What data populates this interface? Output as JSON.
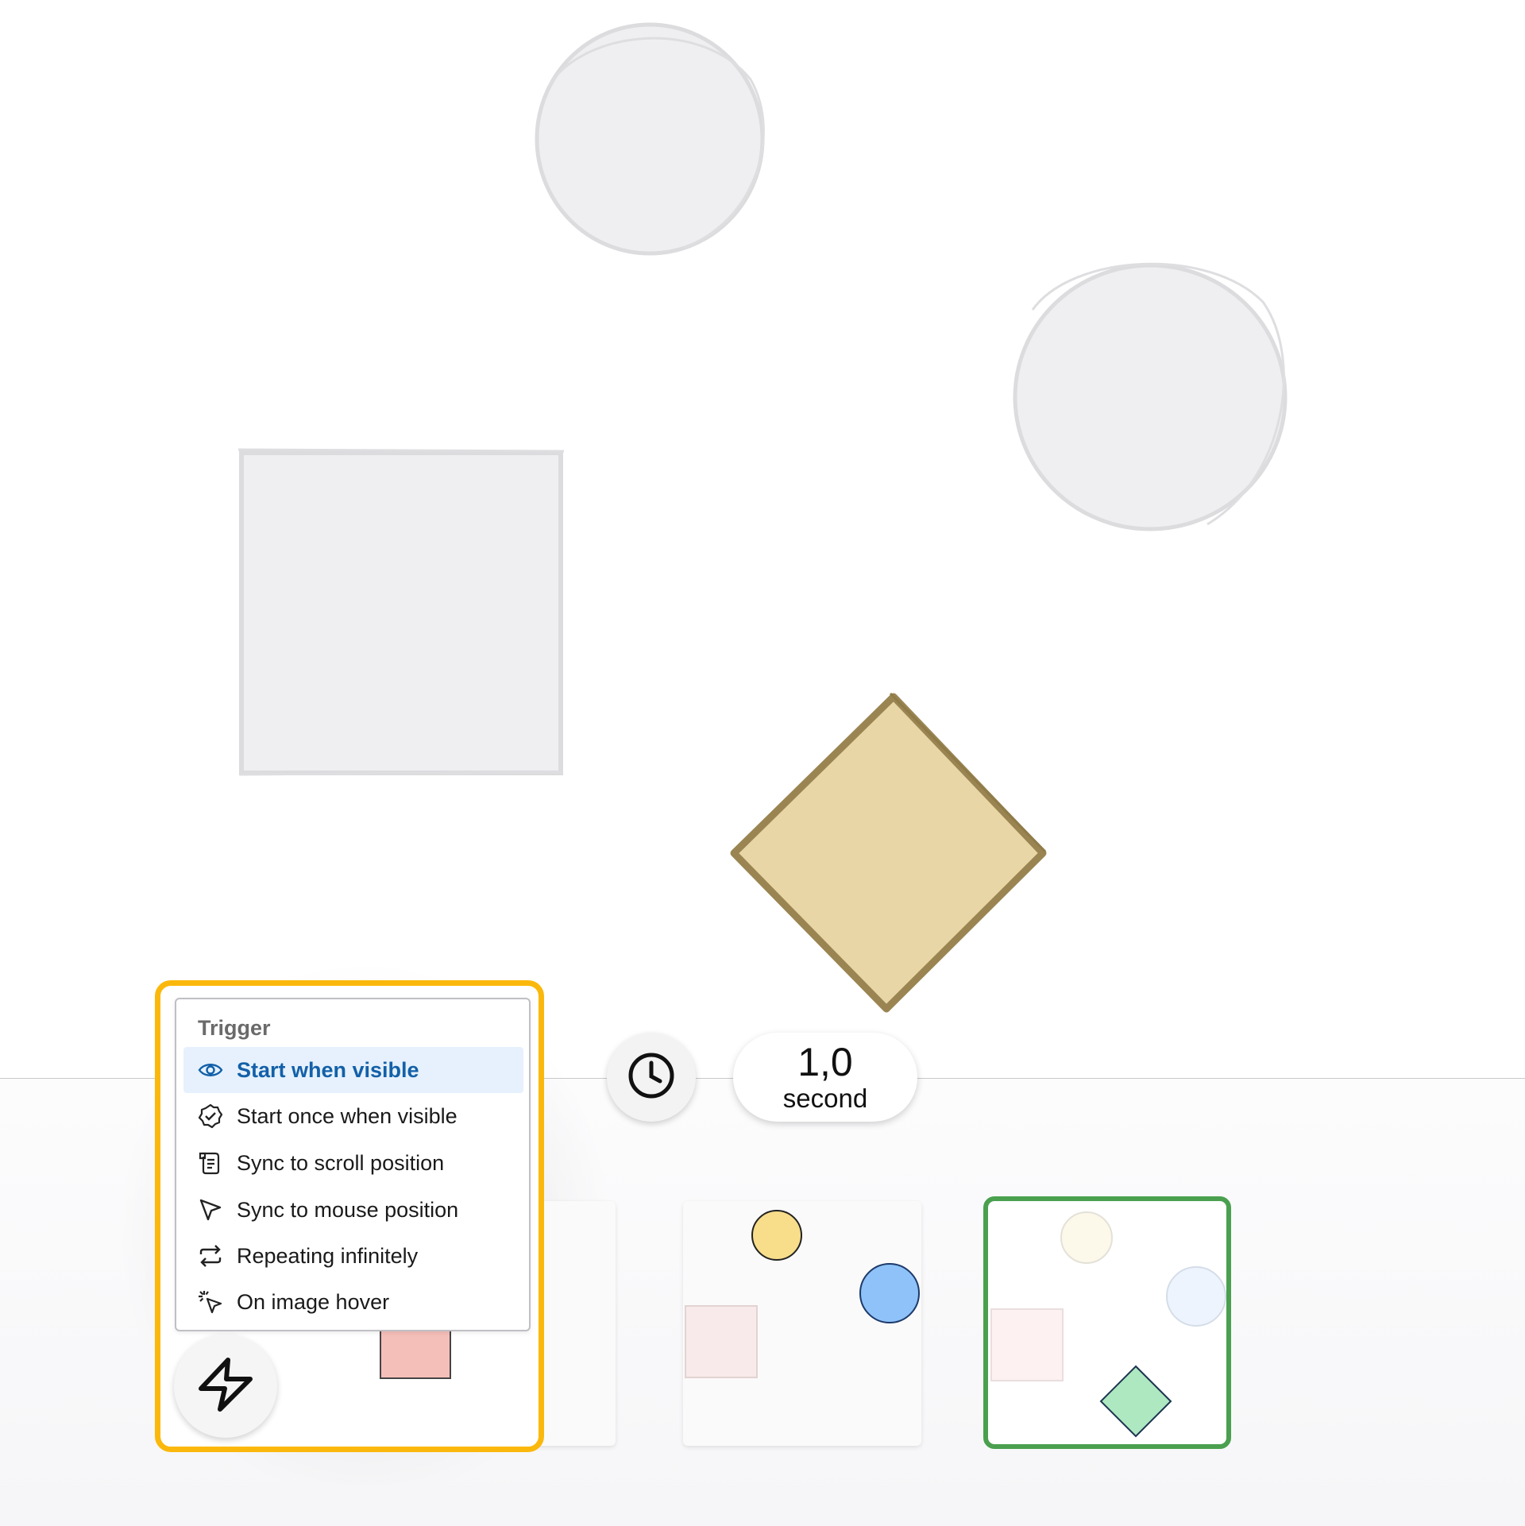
{
  "menu": {
    "title": "Trigger",
    "items": [
      {
        "label": "Start when visible",
        "icon": "eye-icon",
        "selected": true
      },
      {
        "label": "Start once when visible",
        "icon": "check-badge-icon",
        "selected": false
      },
      {
        "label": "Sync to scroll position",
        "icon": "scroll-icon",
        "selected": false
      },
      {
        "label": "Sync to mouse position",
        "icon": "cursor-icon",
        "selected": false
      },
      {
        "label": "Repeating infinitely",
        "icon": "repeat-icon",
        "selected": false
      },
      {
        "label": "On image hover",
        "icon": "click-sparkle-icon",
        "selected": false
      }
    ]
  },
  "duration": {
    "value": "1,0",
    "unit": "second"
  },
  "controls": {
    "trigger_icon": "lightning-icon",
    "timing_icon": "clock-icon"
  },
  "colors": {
    "highlight_border": "#fbb80c",
    "selected_frame_border": "#4aa04f",
    "menu_selected_bg": "#e6f1fd",
    "menu_selected_text": "#1360a8",
    "diamond_fill": "#e8d6a7",
    "diamond_stroke": "#9a8552",
    "ghost_shape_fill": "#efeff1",
    "yellow_circle": "#f8dd8a",
    "blue_circle": "#8ec2f8",
    "pink_square": "#f5bfb9",
    "green_diamond": "#aee8c1"
  }
}
